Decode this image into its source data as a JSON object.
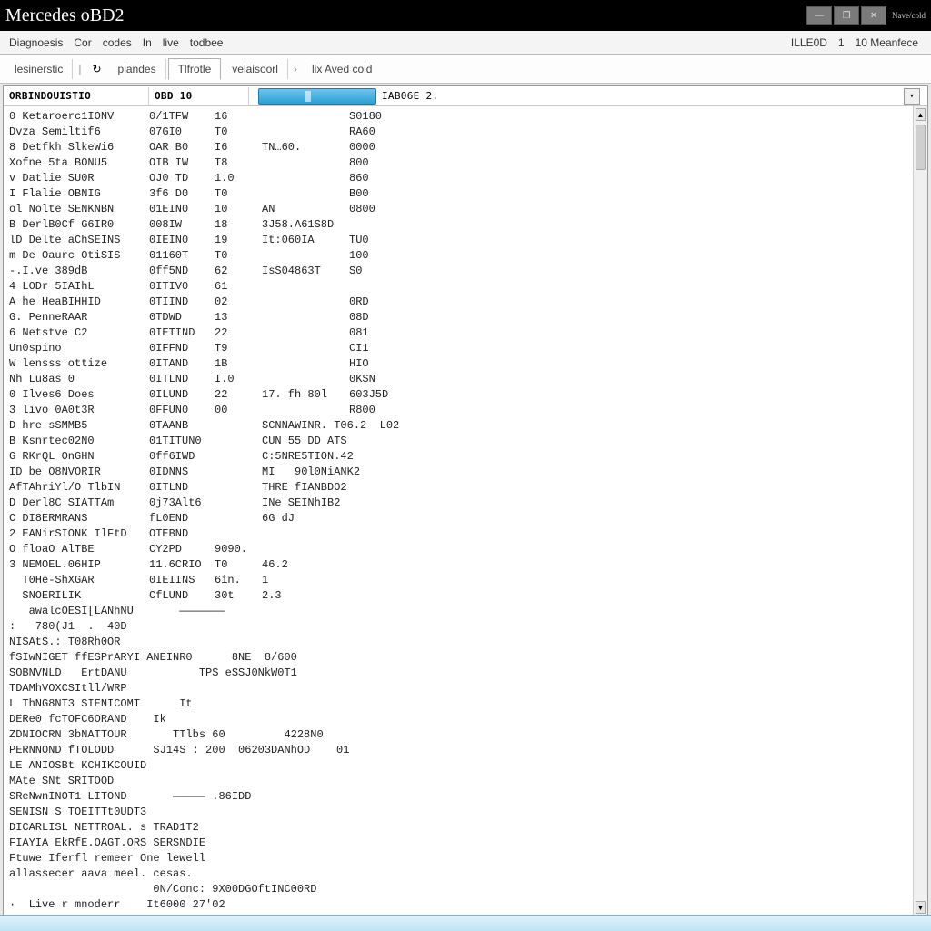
{
  "window": {
    "title": "Mercedes oBD2",
    "caption_btns": {
      "min": "—",
      "max": "❐",
      "close": "✕",
      "extra_label": "Nave/cold"
    }
  },
  "menubar": {
    "items": [
      "Diagnoesis",
      "Cor",
      "codes",
      "In",
      "live",
      "todbee"
    ],
    "right_a": "ILLE0D",
    "right_b": "1",
    "right_c": "10 Meanfece"
  },
  "toolbar": {
    "tabs": [
      {
        "label": "lesinerstic",
        "active": false
      },
      {
        "label": "piandes",
        "active": false
      },
      {
        "label": "Tlfrotle",
        "active": true
      },
      {
        "label": "velaisoorl",
        "active": false
      },
      {
        "label": "lix Aved cold",
        "active": false
      }
    ],
    "refresh_icon": "↻",
    "sep": "›"
  },
  "columns": {
    "c0": "ORBINDOUISTIO",
    "c1": "OBD 10",
    "progress_label": "IAB06E 2.",
    "dropdown_glyph": "▾"
  },
  "rows": [
    {
      "c0": "0 Ketaroerc1IONV",
      "c1": "0/1TFW",
      "c2": "16",
      "c3": "",
      "c4": "S0180"
    },
    {
      "c0": "Dvza Semiltif6",
      "c1": "07GI0",
      "c2": "T0",
      "c3": "",
      "c4": "RA60"
    },
    {
      "c0": "8 Detfkh SlkeWi6",
      "c1": "OAR B0",
      "c2": "I6",
      "c3": "TN…60.",
      "c4": "0000"
    },
    {
      "c0": "Xofne 5ta BONU5",
      "c1": "OIB IW",
      "c2": "T8",
      "c3": "",
      "c4": "800"
    },
    {
      "c0": "v Datlie SU0R",
      "c1": "OJ0 TD",
      "c2": "1.0",
      "c3": "",
      "c4": "860"
    },
    {
      "c0": "I Flalie OBNIG",
      "c1": "3f6 D0",
      "c2": "T0",
      "c3": "",
      "c4": "B00"
    },
    {
      "c0": "ol Nolte SENKNBN",
      "c1": "01EIN0",
      "c2": "10",
      "c3": "AN",
      "c4": "0800"
    },
    {
      "c0": "B DerlB0Cf G6IR0",
      "c1": "008IW",
      "c2": "18",
      "c3": "3J58.A61S8D",
      "c4": ""
    },
    {
      "c0": "lD Delte aChSEINS",
      "c1": "0IEIN0",
      "c2": "19",
      "c3": "It:060IA",
      "c4": "TU0"
    },
    {
      "c0": "m De Oaurc OtiSIS",
      "c1": "01160T",
      "c2": "T0",
      "c3": "",
      "c4": "100"
    },
    {
      "c0": "-.I.ve 389dB",
      "c1": "0ff5ND",
      "c2": "62",
      "c3": "IsS04863T",
      "c4": "S0"
    },
    {
      "c0": "4 LODr 5IAIhL",
      "c1": "0ITIV0",
      "c2": "61",
      "c3": "",
      "c4": ""
    },
    {
      "c0": "A he HeaBIHHID",
      "c1": "0TIIND",
      "c2": "02",
      "c3": "",
      "c4": "0RD"
    },
    {
      "c0": "G. PenneRAAR",
      "c1": "0TDWD",
      "c2": "13",
      "c3": "",
      "c4": "08D"
    },
    {
      "c0": "6 Netstve C2",
      "c1": "0IETIND",
      "c2": "22",
      "c3": "",
      "c4": "081"
    },
    {
      "c0": "Un0spino",
      "c1": "0IFFND",
      "c2": "T9",
      "c3": "",
      "c4": "CI1"
    },
    {
      "c0": "W lensss ottize",
      "c1": "0ITAND",
      "c2": "1B",
      "c3": "",
      "c4": "HIO"
    },
    {
      "c0": "Nh Lu8as 0",
      "c1": "0ITLND",
      "c2": "I.0",
      "c3": "",
      "c4": "0KSN"
    },
    {
      "c0": "0 Ilves6 Does",
      "c1": "0ILUND",
      "c2": "22",
      "c3": "17. fh 80l",
      "c4": "603J5D"
    },
    {
      "c0": "3 livo 0A0t3R",
      "c1": "0FFUN0",
      "c2": "00",
      "c3": "",
      "c4": "R800"
    },
    {
      "c0": "D hre sSMMB5",
      "c1": "0TAANB",
      "c2": "",
      "c3": "SCNNAWINR. T06.2  L02",
      "c4": ""
    },
    {
      "c0": "B Ksnrtec02N0",
      "c1": "01TITUN0",
      "c2": "",
      "c3": "CUN 55 DD ATS",
      "c4": ""
    },
    {
      "c0": "G RKrQL OnGHN",
      "c1": "0ff6IWD",
      "c2": "",
      "c3": "C:5NRE5TION.42",
      "c4": ""
    },
    {
      "c0": "ID be O8NVORIR",
      "c1": "0IDNNS",
      "c2": "",
      "c3": "MI   90l0NiANK2",
      "c4": ""
    },
    {
      "c0": "AfTAhriYl/O TlbIN",
      "c1": "0ITLND",
      "c2": "",
      "c3": "THRE fIANBDO2",
      "c4": ""
    },
    {
      "c0": "D Derl8C SIATTAm",
      "c1": "0j73Alt6",
      "c2": "",
      "c3": "INe SEINhIB2",
      "c4": ""
    },
    {
      "c0": "C DI8ERMRANS",
      "c1": "fL0END",
      "c2": "",
      "c3": "6G dJ",
      "c4": ""
    },
    {
      "c0": "2 EANirSIONK IlFtD",
      "c1": "OTEBND",
      "c2": "",
      "c3": "",
      "c4": ""
    },
    {
      "c0": "O floaO AlTBE",
      "c1": "CY2PD",
      "c2": "9090.",
      "c3": "",
      "c4": ""
    },
    {
      "c0": "3 NEMOEL.06HIP",
      "c1": "11.6CRIO",
      "c2": "T0",
      "c3": "46.2",
      "c4": ""
    },
    {
      "c0": "  T0He-ShXGAR",
      "c1": "0IEIINS",
      "c2": "6in.",
      "c3": "1",
      "c4": ""
    },
    {
      "c0": "  SNOERILIK",
      "c1": "CfLUND",
      "c2": "30t",
      "c3": "2.3",
      "c4": ""
    }
  ],
  "footer_lines": [
    "   awalcOESI[LANhNU       ———————",
    ":   780(J1  .  40D",
    "NISAtS.: T08Rh0OR",
    "fSIwNIGET ffESPrARYI ANEINR0      8NE  8/600",
    "SOBNVNLD   ErtDANU           TPS eSSJ0NkW0T1",
    "TDAMhVOXCSItll/WRP",
    "L ThNG8NT3 SIENICOMT      It",
    "DERe0 fcTOFC6ORAND    Ik",
    "ZDNIOCRN 3bNATTOUR       TTlbs 60         4228N0",
    "PERNNOND fTOLODD      SJ14S : 200  06203DANhOD    01",
    "LE ANIOSBt KCHIKCOUID",
    "MAte SNt SRITOOD",
    "SReNwnINOT1 LITOND       ————— .86IDD",
    "SENISN S TOEITTt0UDT3",
    "DICARLISL NETTROAL. s TRAD1T2",
    "FIAYIA EkRfE.OAGT.ORS SERSNDIE",
    "Ftuwe Iferfl remeer One lewell",
    "allassecer aava meel. cesas.",
    "                      0N/Conc: 9X00DGOftINC00RD",
    "",
    "·  Live r mnoderr    It6000 27'02"
  ]
}
